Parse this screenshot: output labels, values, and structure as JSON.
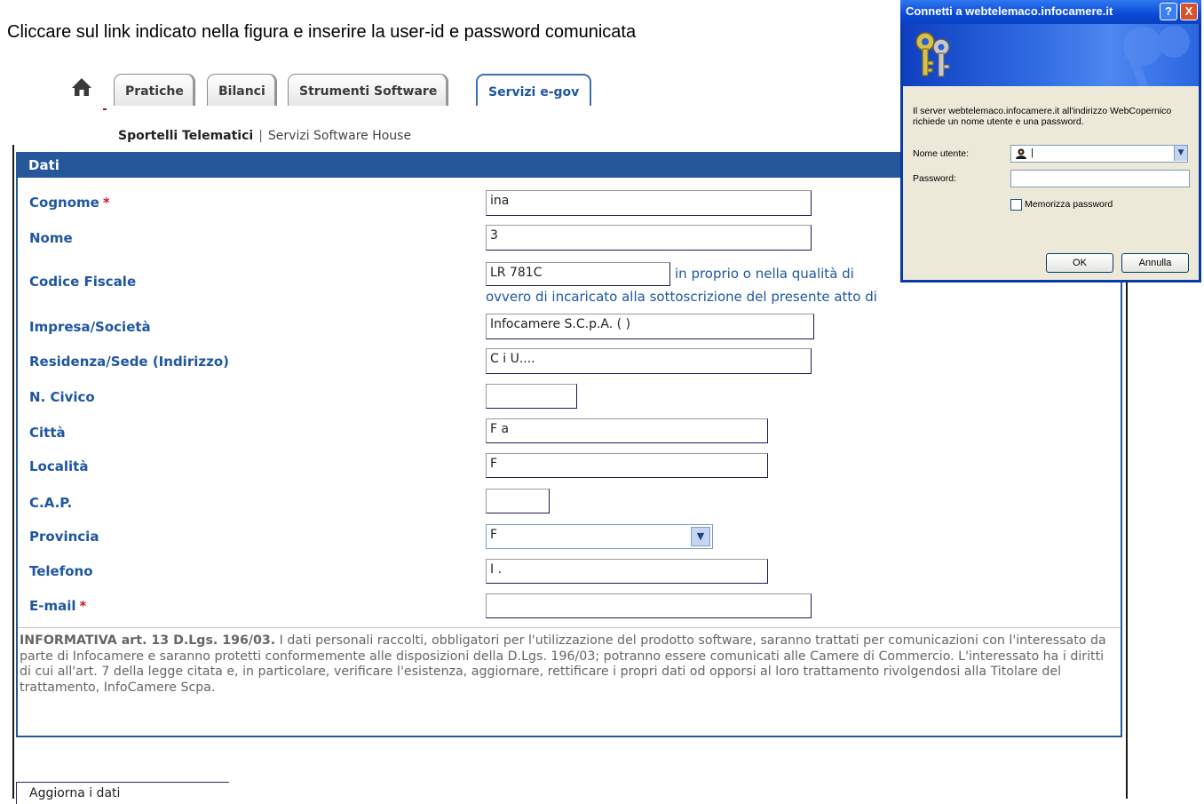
{
  "instruction": "Cliccare sul link indicato nella figura e inserire la user-id e password comunicata",
  "nav": {
    "tabs": [
      {
        "label": "Pratiche"
      },
      {
        "label": "Bilanci"
      },
      {
        "label": "Strumenti Software"
      },
      {
        "label": "Servizi e-gov",
        "active": true
      }
    ],
    "subnav": {
      "active": "Sportelli Telematici",
      "separator": "|",
      "other": "Servizi Software House"
    }
  },
  "panel": {
    "header": "Dati",
    "required_marker": "*",
    "fields": {
      "cognome": {
        "label": "Cognome",
        "value": "   ina",
        "required": true
      },
      "nome": {
        "label": "Nome",
        "value": "   3"
      },
      "codice_fiscale": {
        "label": "Codice Fiscale",
        "value": "LR       781C",
        "note1": "in proprio o nella qualità di",
        "note2": "ovvero di incaricato alla sottoscrizione del presente atto di"
      },
      "impresa": {
        "label": "Impresa/Società",
        "value": "Infocamere S.C.p.A. (        )"
      },
      "residenza": {
        "label": "Residenza/Sede (Indirizzo)",
        "value": "C      i U...."
      },
      "civico": {
        "label": "N. Civico",
        "value": ""
      },
      "citta": {
        "label": "Città",
        "value": "F     a"
      },
      "localita": {
        "label": "Località",
        "value": "F"
      },
      "cap": {
        "label": "C.A.P.",
        "value": ""
      },
      "provincia": {
        "label": "Provincia",
        "value": "F       "
      },
      "telefono": {
        "label": "Telefono",
        "value": "  I ."
      },
      "email": {
        "label": "E-mail",
        "value": "",
        "required": true
      }
    },
    "informativa_title": "INFORMATIVA art. 13 D.Lgs. 196/03.",
    "informativa_text": "I dati personali raccolti, obbligatori per l'utilizzazione del prodotto software, saranno trattati per comunicazioni con l'interessato da parte di Infocamere e saranno protetti conformemente alle disposizioni della D.Lgs. 196/03; potranno essere comunicati alle Camere di Commercio. L'interessato ha i diritti di cui all'art. 7 della legge citata e, in particolare, verificare l'esistenza, aggiornare, rettificare i propri dati od opporsi al loro trattamento rivolgendosi alla Titolare del trattamento, InfoCamere Scpa."
  },
  "footer": {
    "update_button": "Aggiorna i dati"
  },
  "dialog": {
    "title": "Connetti a webtelemaco.infocamere.it",
    "help": "?",
    "close": "X",
    "message": "Il server webtelemaco.infocamere.it all'indirizzo WebCopernico richiede un nome utente e una password.",
    "username_label": "Nome utente:",
    "username_value": "|",
    "password_label": "Password:",
    "remember_label": "Memorizza password",
    "ok": "OK",
    "cancel": "Annulla"
  }
}
